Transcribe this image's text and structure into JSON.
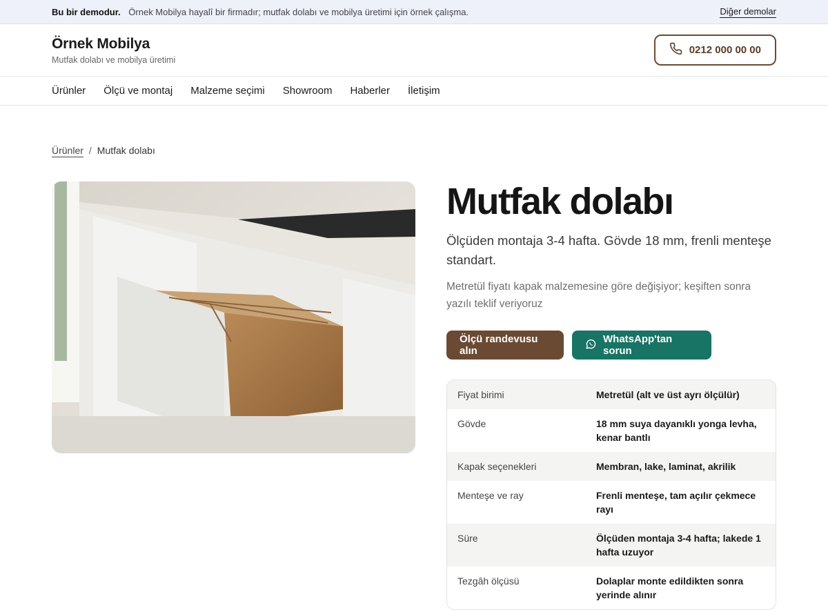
{
  "demo_bar": {
    "label": "Bu bir demodur.",
    "text": "Örnek Mobilya hayalî bir firmadır; mutfak dolabı ve mobilya üretimi için örnek çalışma.",
    "link": "Diğer demolar"
  },
  "header": {
    "brand": "Örnek Mobilya",
    "tagline": "Mutfak dolabı ve mobilya üretimi",
    "phone": "0212 000 00 00",
    "phone_icon": "phone-icon"
  },
  "nav": [
    "Ürünler",
    "Ölçü ve montaj",
    "Malzeme seçimi",
    "Showroom",
    "Haberler",
    "İletişim"
  ],
  "breadcrumb": {
    "parent": "Ürünler",
    "separator": "/",
    "current": "Mutfak dolabı"
  },
  "product": {
    "title": "Mutfak dolabı",
    "lead": "Ölçüden montaja 3-4 hafta. Gövde 18 mm, frenli menteşe standart.",
    "note": "Metretül fiyatı kapak malzemesine göre değişiyor; keşiften sonra yazılı teklif veriyoruz",
    "cta_primary": "Ölçü randevusu alın",
    "cta_whatsapp": "WhatsApp'tan sorun"
  },
  "specs": [
    {
      "key": "Fiyat birimi",
      "value": "Metretül (alt ve üst ayrı ölçülür)"
    },
    {
      "key": "Gövde",
      "value": "18 mm suya dayanıklı yonga levha, kenar bantlı"
    },
    {
      "key": "Kapak seçenekleri",
      "value": "Membran, lake, laminat, akrilik"
    },
    {
      "key": "Menteşe ve ray",
      "value": "Frenli menteşe, tam açılır çekmece rayı"
    },
    {
      "key": "Süre",
      "value": "Ölçüden montaja 3-4 hafta; lakede 1 hafta uzuyor"
    },
    {
      "key": "Tezgâh ölçüsü",
      "value": "Dolaplar monte edildikten sonra yerinde alınır"
    }
  ],
  "colors": {
    "brand_brown": "#6b4a33",
    "whatsapp_green": "#187464",
    "demo_bar_bg": "#eef0fa"
  }
}
